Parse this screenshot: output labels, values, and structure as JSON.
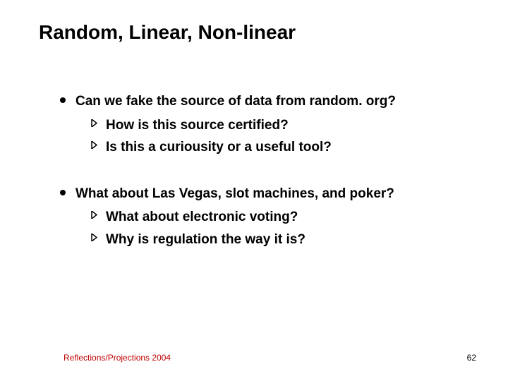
{
  "title": "Random, Linear, Non-linear",
  "items": [
    {
      "text": "Can we fake the source of data from random. org?",
      "sub": [
        "How is this source certified?",
        "Is this a curiousity or a useful tool?"
      ]
    },
    {
      "text": "What about Las Vegas, slot machines, and poker?",
      "sub": [
        "What about electronic voting?",
        "Why is regulation the way it is?"
      ]
    }
  ],
  "footer": {
    "left": "Reflections/Projections 2004",
    "right": "62"
  }
}
